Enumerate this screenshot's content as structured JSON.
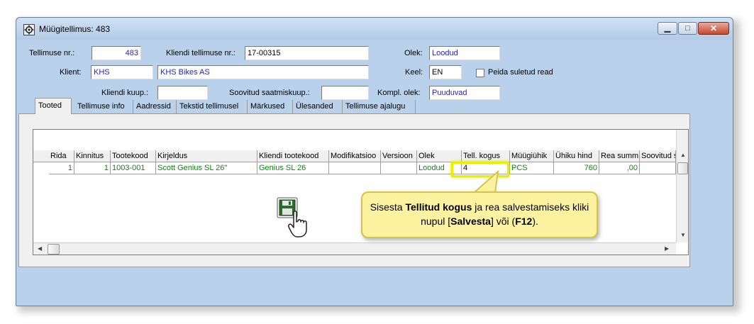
{
  "window": {
    "title": "Müügitellimus: 483",
    "min_glyph": "▁",
    "max_glyph": "□",
    "close_glyph": "✕"
  },
  "header": {
    "order_no_label": "Tellimuse nr.:",
    "order_no": "483",
    "client_order_label": "Kliendi tellimuse nr.:",
    "client_order": "17-00315",
    "state_label": "Olek:",
    "state": "Loodud",
    "client_label": "Klient:",
    "client_code": "KHS",
    "client_name": "KHS Bikes AS",
    "lang_label": "Keel:",
    "lang": "EN",
    "hide_closed_label": "Peida suletud read",
    "client_date_label": "Kliendi kuup.:",
    "client_date": "",
    "ship_date_label": "Soovitud saatmiskuup.:",
    "ship_date": "",
    "compl_state_label": "Kompl. olek:",
    "compl_state": "Puuduvad"
  },
  "tabs": [
    "Tooted",
    "Tellimuse info",
    "Aadressid",
    "Tekstid tellimusel",
    "Märkused",
    "Ülesanded",
    "Tellimuse ajalugu"
  ],
  "grid": {
    "columns": [
      "Rida",
      "Kinnitus",
      "Tootekood",
      "Kirjeldus",
      "Kliendi tootekood",
      "Modifikatsioo",
      "Versioon",
      "Olek",
      "Tell. kogus",
      "Müügiühik",
      "Ühiku hind",
      "Rea summ",
      "Soovitud saa"
    ],
    "rows": [
      [
        "1",
        "1",
        "1003-001",
        "Scott Genius SL 26''",
        "Genius SL 26",
        "",
        "",
        "Loodud",
        "4",
        "PCS",
        "760",
        ",00",
        ""
      ]
    ]
  },
  "callout": {
    "text1": "Sisesta ",
    "bold1": "Tellitud kogus",
    "text2": " ja rea salvestamiseks kliki nupul [",
    "bold2": "Salvesta",
    "text3": "] või (",
    "bold3": "F12",
    "text4": ")."
  },
  "icons": {
    "app": "app-icon",
    "save": "floppy-disk-icon",
    "hand": "hand-cursor-icon"
  },
  "colors": {
    "field_value": "#1f1fd0",
    "row_text": "#0b8a0b",
    "callout_bg": "#fdf2a0",
    "highlight": "#e6f000"
  }
}
